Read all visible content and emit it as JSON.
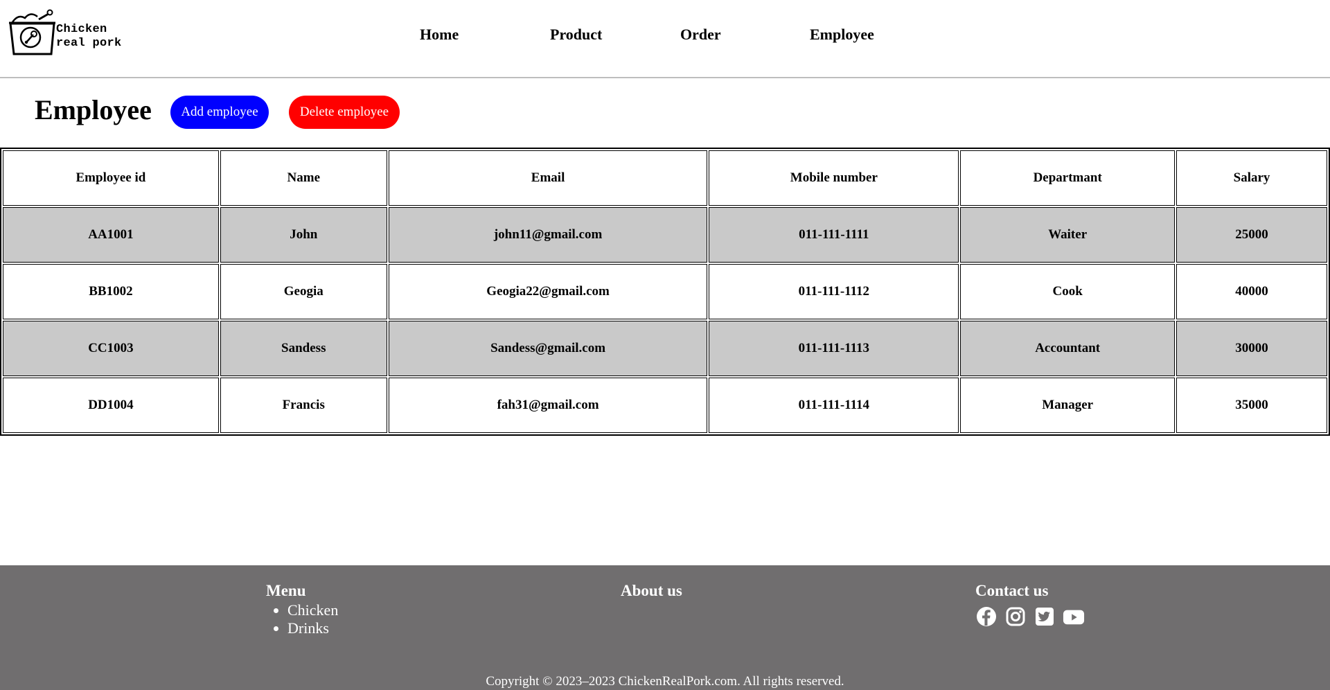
{
  "brand": {
    "line1": "Chicken",
    "line2": "real pork"
  },
  "nav": [
    {
      "label": "Home"
    },
    {
      "label": "Product"
    },
    {
      "label": "Order"
    },
    {
      "label": "Employee"
    }
  ],
  "page": {
    "title": "Employee"
  },
  "actions": {
    "add_label": "Add employee",
    "delete_label": "Delete employee"
  },
  "colors": {
    "add": "#0000ff",
    "delete": "#ff0000",
    "footer": "#706e6f",
    "row_alt": "#c9c9c9"
  },
  "table": {
    "columns": [
      "Employee id",
      "Name",
      "Email",
      "Mobile number",
      "Departmant",
      "Salary"
    ],
    "rows": [
      [
        "AA1001",
        "John",
        "john11@gmail.com",
        "011-111-1111",
        "Waiter",
        "25000"
      ],
      [
        "BB1002",
        "Geogia",
        "Geogia22@gmail.com",
        "011-111-1112",
        "Cook",
        "40000"
      ],
      [
        "CC1003",
        "Sandess",
        "Sandess@gmail.com",
        "011-111-1113",
        "Accountant",
        "30000"
      ],
      [
        "DD1004",
        "Francis",
        "fah31@gmail.com",
        "011-111-1114",
        "Manager",
        "35000"
      ]
    ]
  },
  "footer": {
    "menu_title": "Menu",
    "menu_items": [
      "Chicken",
      "Drinks"
    ],
    "about_title": "About us",
    "contact_title": "Contact us",
    "socials": [
      "facebook-icon",
      "instagram-icon",
      "twitter-icon",
      "youtube-icon"
    ],
    "copyright": "Copyright © 2023–2023 ChickenRealPork.com. All rights reserved."
  }
}
